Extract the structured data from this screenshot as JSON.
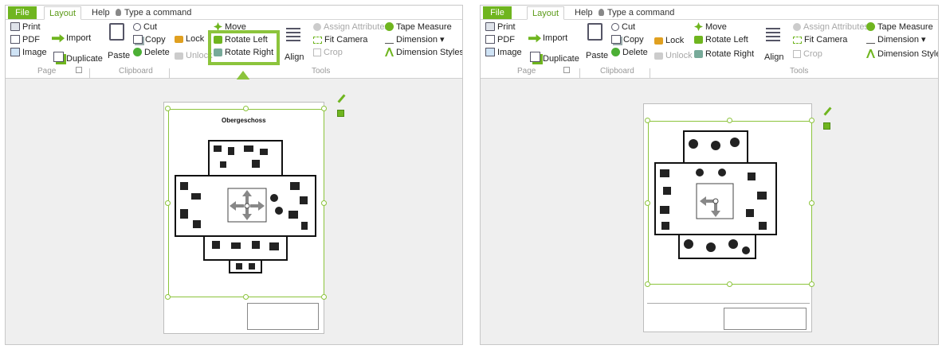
{
  "tabs": {
    "file": "File",
    "layout": "Layout",
    "help": "Help"
  },
  "command_hint": "Type a command",
  "page_group": {
    "print": "Print",
    "pdf": "PDF",
    "image": "Image",
    "label": "Page"
  },
  "import_label": "Import",
  "duplicate_label": "Duplicate",
  "clipboard_group": {
    "paste": "Paste",
    "cut": "Cut",
    "copy": "Copy",
    "delete": "Delete",
    "label": "Clipboard"
  },
  "lock_label": "Lock",
  "unlock_label": "Unlock",
  "move_label": "Move",
  "rotate_left_label": "Rotate Left",
  "rotate_right_label": "Rotate Right",
  "align_label": "Align",
  "tools_group": {
    "assign_attributes": "Assign Attributes",
    "fit_camera": "Fit Camera",
    "crop": "Crop",
    "tape_measure": "Tape Measure",
    "dimension": "Dimension",
    "dimension_styles": "Dimension Styles",
    "label": "Tools"
  },
  "sheet_title": "Obergeschoss",
  "colors": {
    "accent": "#8cc43c",
    "file_tab": "#6fb51f",
    "canvas": "#efefef"
  },
  "callout": {
    "target": "rotate-right",
    "icon": "arrow-up-icon"
  }
}
